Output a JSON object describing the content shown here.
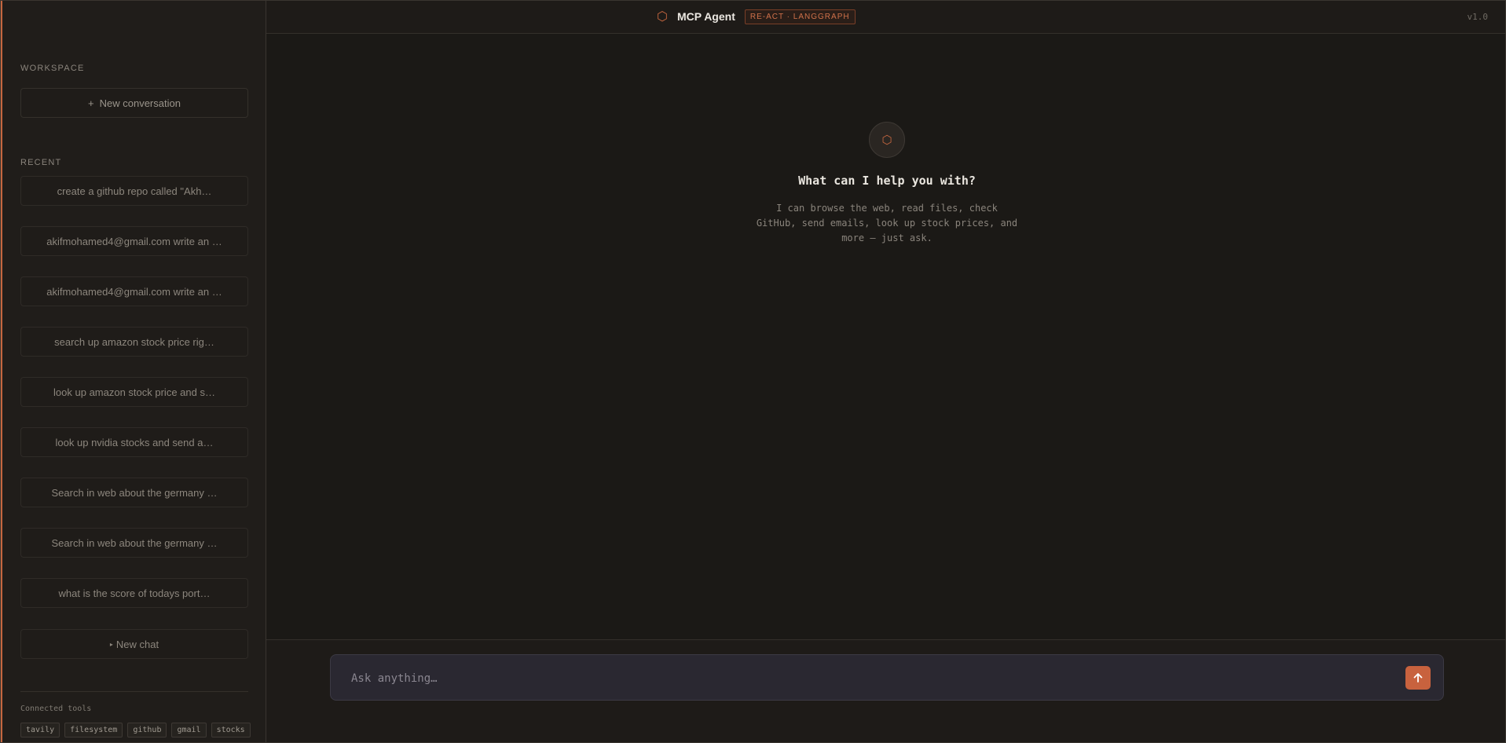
{
  "header": {
    "brand_icon": "hexagon-icon",
    "brand_name": "MCP Agent",
    "badge": "RE-ACT · LANGGRAPH",
    "version": "v1.0",
    "accent_color": "#c4663f"
  },
  "sidebar": {
    "workspace_label": "WORKSPACE",
    "new_conversation_label": "New conversation",
    "recent_label": "RECENT",
    "recent_items": [
      "create a github repo called \"Akh…",
      "akifmohamed4@gmail.com write an …",
      "akifmohamed4@gmail.com write an …",
      "search up amazon stock price rig…",
      "look up amazon stock price and s…",
      "look up nvidia stocks and send a…",
      "Search in web about the germany …",
      "Search in web about the germany …",
      "what is the score of todays port…"
    ],
    "new_chat_label": "New chat",
    "tools_label": "Connected tools",
    "tools": [
      "tavily",
      "filesystem",
      "github",
      "gmail",
      "stocks"
    ]
  },
  "main": {
    "hero_icon": "hexagon-icon",
    "title": "What can I help you with?",
    "description": "I can browse the web, read files, check GitHub, send emails, look up stock prices, and more — just ask."
  },
  "composer": {
    "placeholder": "Ask anything…",
    "send_icon": "arrow-up-icon"
  }
}
